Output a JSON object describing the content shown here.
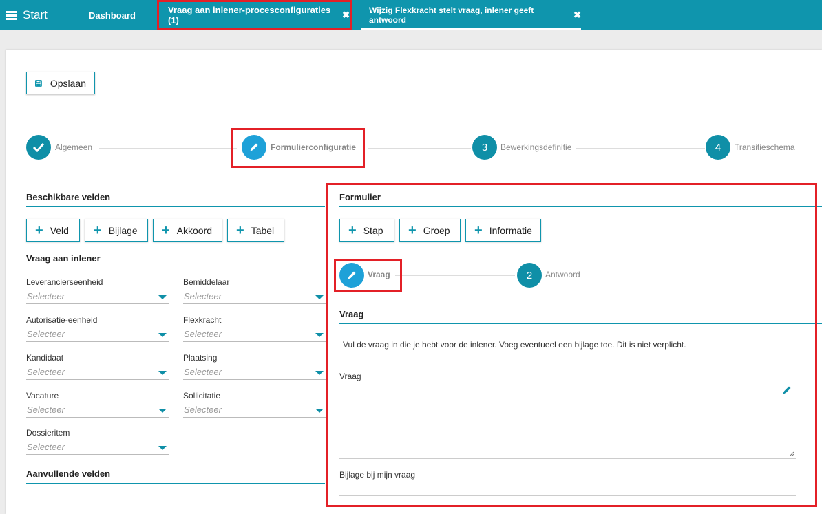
{
  "topbar": {
    "start_label": "Start",
    "tabs": [
      {
        "label": "Dashboard"
      },
      {
        "label": "Vraag aan inlener-procesconfiguraties (1)"
      },
      {
        "label": "Wijzig Flexkracht stelt vraag, inlener geeft antwoord"
      }
    ],
    "close_glyph": "✖"
  },
  "toolbar": {
    "save_label": "Opslaan"
  },
  "stepper": [
    {
      "label": "Algemeen",
      "state": "done"
    },
    {
      "label": "Formulierconfiguratie",
      "state": "active"
    },
    {
      "number": "3",
      "label": "Bewerkingsdefinitie",
      "state": "todo"
    },
    {
      "number": "4",
      "label": "Transitieschema",
      "state": "todo"
    }
  ],
  "available": {
    "title": "Beschikbare velden",
    "buttons": [
      "Veld",
      "Bijlage",
      "Akkoord",
      "Tabel"
    ],
    "group_title": "Vraag aan inlener",
    "placeholder": "Selecteer",
    "fields": [
      "Leverancierseenheid",
      "Bemiddelaar",
      "Autorisatie-eenheid",
      "Flexkracht",
      "Kandidaat",
      "Plaatsing",
      "Vacature",
      "Sollicitatie",
      "Dossieritem"
    ],
    "extra_title": "Aanvullende velden"
  },
  "form": {
    "title": "Formulier",
    "buttons": [
      "Stap",
      "Groep",
      "Informatie"
    ],
    "substeps": [
      {
        "label": "Vraag",
        "state": "active"
      },
      {
        "number": "2",
        "label": "Antwoord",
        "state": "todo"
      }
    ],
    "section_title": "Vraag",
    "description": "Vul de vraag in die je hebt voor de inlener. Voeg eventueel een bijlage toe. Dit is niet verplicht.",
    "question_label": "Vraag",
    "attachment_label": "Bijlage bij mijn vraag"
  },
  "colors": {
    "accent": "#0f95ad",
    "active_step": "#1ea1d8",
    "highlight": "#e32027"
  }
}
